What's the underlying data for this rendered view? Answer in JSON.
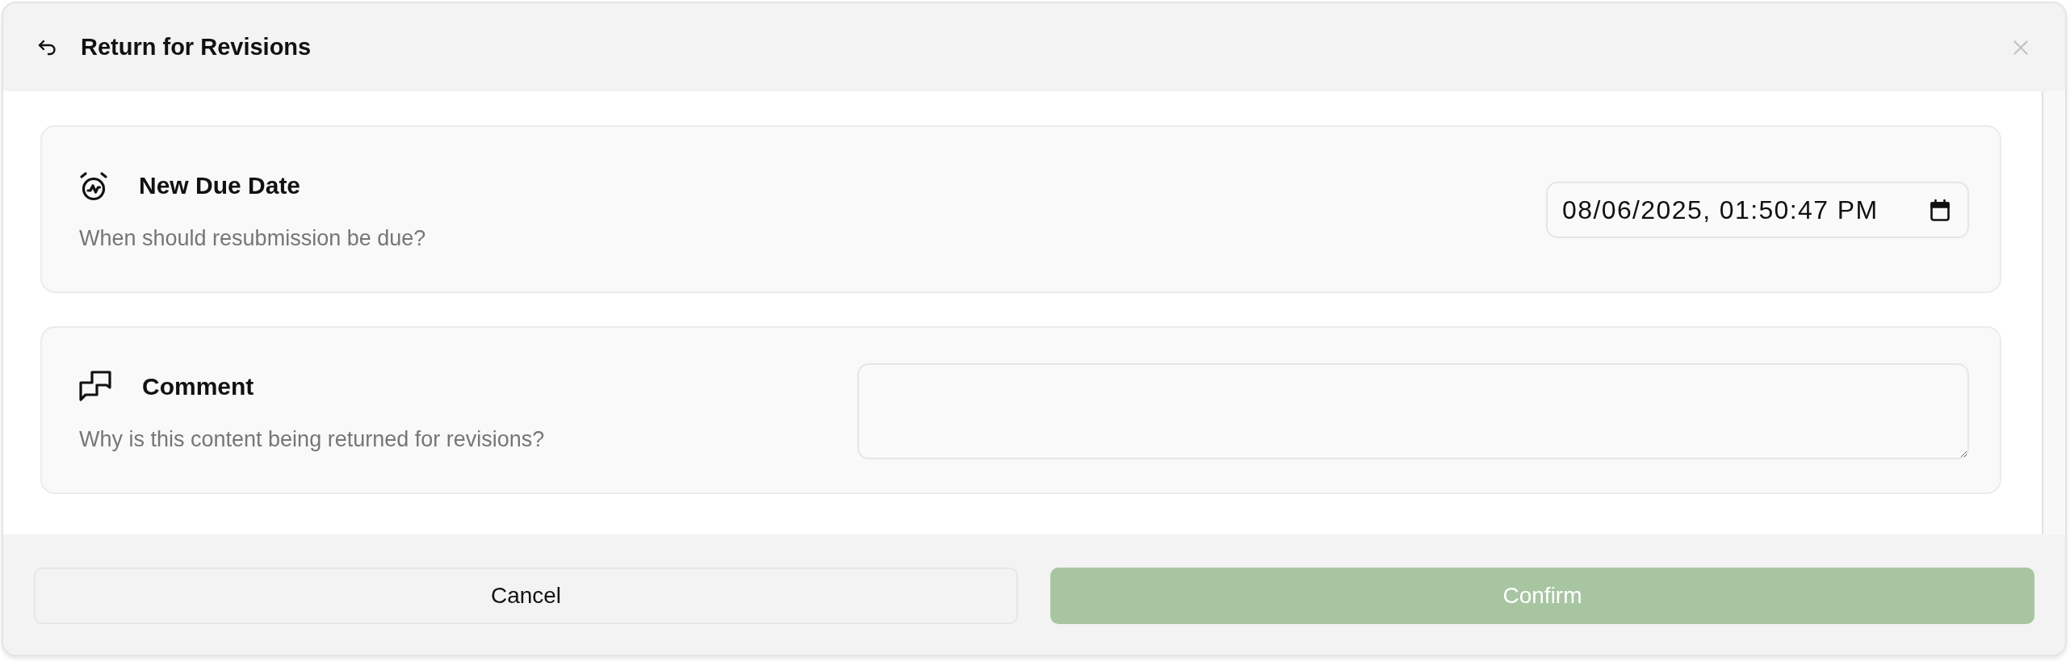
{
  "dialog": {
    "title": "Return for Revisions"
  },
  "sections": [
    {
      "kind": "date",
      "title": "New Due Date",
      "description": "When should resubmission be due?",
      "value": "08/06/2025, 01:50:47 PM"
    },
    {
      "kind": "comment",
      "title": "Comment",
      "description": "Why is this content being returned for revisions?"
    }
  ],
  "buttons": [
    {
      "kind": "secondary",
      "label": "Cancel",
      "disabled": false
    },
    {
      "kind": "primary",
      "label": "Confirm",
      "disabled": true
    }
  ]
}
